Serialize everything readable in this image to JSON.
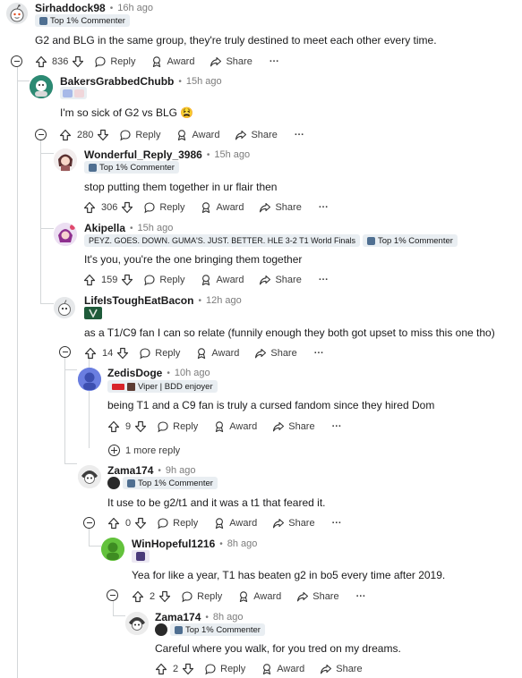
{
  "comments": [
    {
      "id": "c1",
      "username": "Sirhaddock98",
      "time": "16h ago",
      "flairs": [
        "Top 1% Commenter"
      ],
      "body": "G2 and BLG in the same group, they're truly destined to meet each other every time.",
      "votes": "836"
    },
    {
      "id": "c2",
      "username": "BakersGrabbedChubb",
      "time": "15h ago",
      "flairs": [],
      "body": "I'm so sick of G2 vs BLG 😫",
      "votes": "280"
    },
    {
      "id": "c3",
      "username": "Wonderful_Reply_3986",
      "time": "15h ago",
      "flairs": [
        "Top 1% Commenter"
      ],
      "body": "stop putting them together in ur flair then",
      "votes": "306"
    },
    {
      "id": "c4",
      "username": "Akipella",
      "time": "15h ago",
      "flairs": [
        "PEYZ. GOES. DOWN. GUMA'S. JUST. BETTER. HLE 3-2 T1 World Finals",
        "Top 1% Commenter"
      ],
      "body": "It's you, you're the one bringing them together",
      "votes": "159"
    },
    {
      "id": "c5",
      "username": "LifeIsToughEatBacon",
      "time": "12h ago",
      "flairs": [],
      "body": "as a T1/C9 fan I can so relate (funnily enough they both got upset to miss this one tho)",
      "votes": "14"
    },
    {
      "id": "c6",
      "username": "ZedisDoge",
      "time": "10h ago",
      "flairs": [
        "Viper | BDD enjoyer"
      ],
      "body": "being T1 and a C9 fan is truly a cursed fandom since they hired Dom",
      "votes": "9"
    },
    {
      "id": "c7",
      "username": "Zama174",
      "time": "9h ago",
      "flairs": [
        "Top 1% Commenter"
      ],
      "body": "It use to be g2/t1 and it was a t1 that feared it.",
      "votes": "0"
    },
    {
      "id": "c8",
      "username": "WinHopeful1216",
      "time": "8h ago",
      "flairs": [],
      "body": "Yea for like a year, T1 has beaten g2 in bo5 every time after 2019.",
      "votes": "2"
    },
    {
      "id": "c9",
      "username": "Zama174",
      "time": "8h ago",
      "flairs": [
        "Top 1% Commenter"
      ],
      "body": "Careful where you walk, for you tred on my dreams.",
      "votes": "2"
    }
  ],
  "labels": {
    "dot": "•",
    "reply": "Reply",
    "award": "Award",
    "share": "Share",
    "more_options": "···",
    "more_replies": "1 more reply"
  },
  "colors": {
    "flair_bg": "#e9eef2",
    "thread_line": "#d4d7d9",
    "timestamp": "#7c7c7c"
  }
}
